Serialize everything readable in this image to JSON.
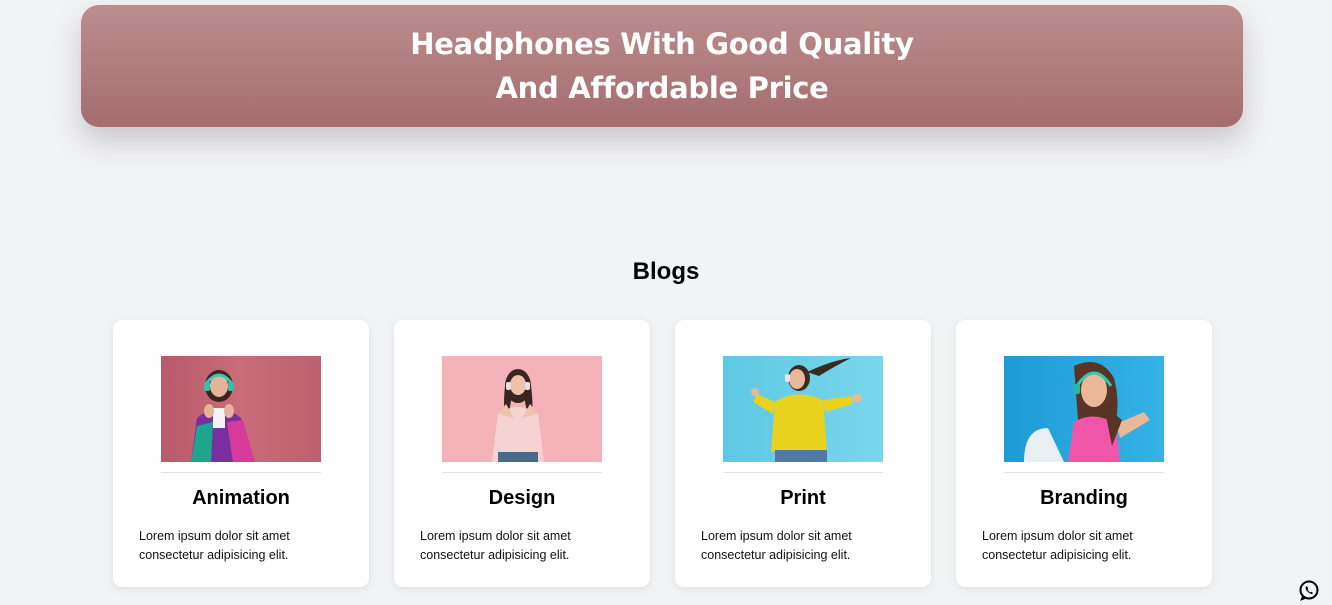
{
  "hero": {
    "title": "Headphones With Good Quality And Affordable Price"
  },
  "blogs": {
    "heading": "Blogs",
    "cards": [
      {
        "title": "Animation",
        "text": "Lorem ipsum dolor sit amet consectetur adipisicing elit.",
        "image_bg": "#c26572",
        "image_label": "woman-pink-background"
      },
      {
        "title": "Design",
        "text": "Lorem ipsum dolor sit amet consectetur adipisicing elit.",
        "image_bg": "#f4b6bb",
        "image_label": "woman-light-pink-background"
      },
      {
        "title": "Print",
        "text": "Lorem ipsum dolor sit amet consectetur adipisicing elit.",
        "image_bg": "#59c9e3",
        "image_label": "woman-cyan-background"
      },
      {
        "title": "Branding",
        "text": "Lorem ipsum dolor sit amet consectetur adipisicing elit.",
        "image_bg": "#27a3d8",
        "image_label": "woman-blue-background"
      }
    ]
  },
  "floating": {
    "icon": "whatsapp-icon"
  },
  "colors": {
    "hero_top": "#bb8e8e",
    "hero_bottom": "#a56c6e",
    "page_bg": "#f2f3f5"
  }
}
